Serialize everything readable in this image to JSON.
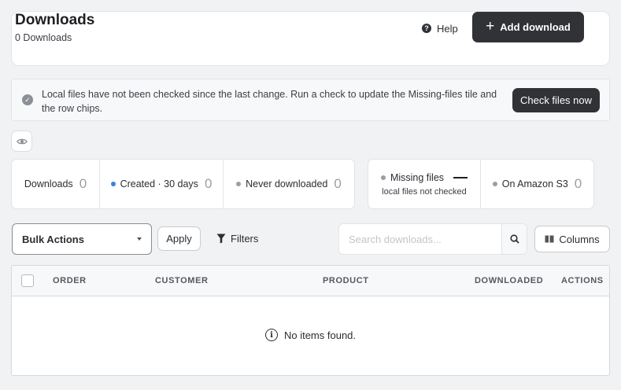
{
  "header": {
    "title": "Downloads",
    "subtitle": "0 Downloads",
    "help_label": "Help",
    "help_icon": "question-circle-icon",
    "add_label": "Add download",
    "add_icon": "plus-icon"
  },
  "notice": {
    "icon": "check-circle-icon",
    "text": "Local files have not been checked since the last change. Run a check to update the Missing-files tile and the row chips.",
    "button_label": "Check files now"
  },
  "visibility_toggle": {
    "icon": "eye-icon"
  },
  "stats": {
    "downloads": {
      "label": "Downloads",
      "value": "0"
    },
    "created": {
      "label": "Created · 30 days",
      "value": "0",
      "dot_color": "#3b82d6"
    },
    "never_downloaded": {
      "label": "Never downloaded",
      "value": "0",
      "dot_color": "#9a9ea4"
    },
    "missing_files": {
      "label": "Missing files",
      "sub": "local files not checked",
      "dot_color": "#9a9ea4"
    },
    "amazon_s3": {
      "label": "On Amazon S3",
      "value": "0",
      "dot_color": "#9a9ea4"
    }
  },
  "toolbar": {
    "bulk_actions": "Bulk Actions",
    "apply_label": "Apply",
    "filters_label": "Filters",
    "filters_icon": "funnel-icon",
    "search_placeholder": "Search downloads...",
    "search_icon": "magnifier-icon",
    "columns_label": "Columns",
    "columns_icon": "columns-icon"
  },
  "table": {
    "columns": [
      "Order",
      "Customer",
      "Product",
      "Downloaded",
      "Actions"
    ],
    "empty_message": "No items found.",
    "empty_icon": "info-icon"
  }
}
